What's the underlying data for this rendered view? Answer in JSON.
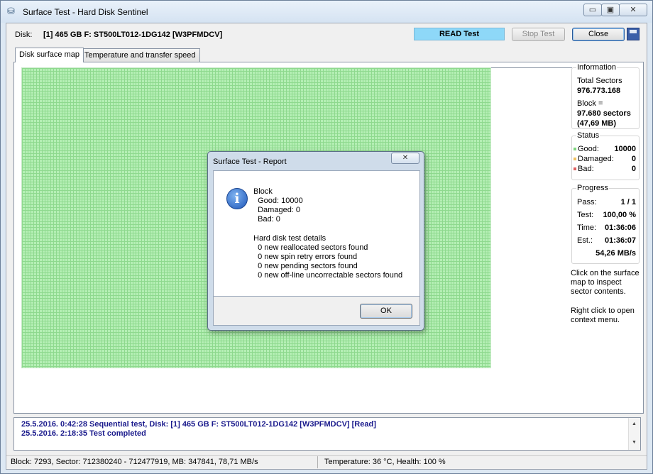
{
  "window": {
    "title": "Surface Test - Hard Disk Sentinel",
    "minimize": "▭",
    "maximize": "▣",
    "close": "✕"
  },
  "toolbar": {
    "disk_label": "Disk:",
    "disk_value": "[1] 465 GB F: ST500LT012-1DG142 [W3PFMDCV]",
    "read_test": "READ Test",
    "stop_test": "Stop Test",
    "close": "Close"
  },
  "tabs": [
    {
      "label": "Disk surface map",
      "active": true
    },
    {
      "label": "Temperature and transfer speed",
      "active": false
    }
  ],
  "info": {
    "title": "Information",
    "total_sectors_label": "Total Sectors",
    "total_sectors_value": "976.773.168",
    "block_label": "Block =",
    "block_sectors": "97.680 sectors",
    "block_mb": "(47,69 MB)"
  },
  "status": {
    "title": "Status",
    "good_label": "Good:",
    "good_value": "10000",
    "damaged_label": "Damaged:",
    "damaged_value": "0",
    "bad_label": "Bad:",
    "bad_value": "0"
  },
  "progress": {
    "title": "Progress",
    "pass_label": "Pass:",
    "pass_value": "1 / 1",
    "test_label": "Test:",
    "test_value": "100,00 %",
    "time_label": "Time:",
    "time_value": "01:36:06",
    "est_label": "Est.:",
    "est_value": "01:36:07",
    "speed": "54,26 MB/s"
  },
  "hints": {
    "hint1": [
      "Click on the surface",
      "map to inspect",
      "sector contents."
    ],
    "hint2": [
      "Right click to open",
      "context menu."
    ]
  },
  "log": [
    "25.5.2016.  0:42:28  Sequential test, Disk: [1] 465 GB F: ST500LT012-1DG142 [W3PFMDCV] [Read]",
    "25.5.2016.  2:18:35  Test completed"
  ],
  "statusbar": {
    "left": "Block: 7293, Sector: 712380240 - 712477919, MB: 347841, 78,71 MB/s",
    "right": "Temperature: 36  °C,  Health: 100 %"
  },
  "dialog": {
    "title": "Surface Test - Report",
    "close": "✕",
    "lines": [
      "Block",
      "  Good: 10000",
      "  Damaged: 0",
      "  Bad: 0",
      "",
      "Hard disk test details",
      "  0 new reallocated sectors found",
      "  0 new spin retry errors found",
      "  0 new pending sectors found",
      "  0 new off-line uncorrectable sectors found"
    ],
    "ok": "OK"
  },
  "colors": {
    "good": "#b5efb5",
    "read_test": "#8ed8f8",
    "log_text": "#1a1a8c"
  }
}
